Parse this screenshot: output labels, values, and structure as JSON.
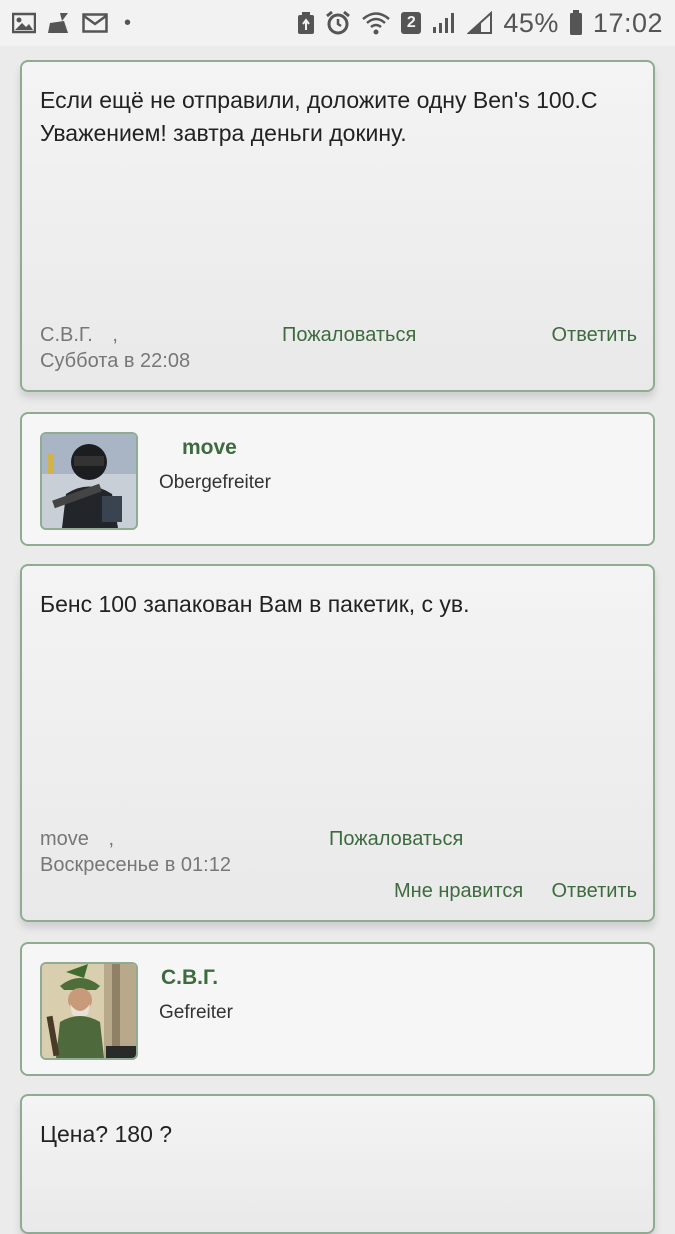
{
  "status_bar": {
    "battery": "45%",
    "time": "17:02",
    "sim_badge": "2",
    "icons": [
      "gallery-icon",
      "cleaner-icon",
      "mail-icon",
      "dot-icon",
      "battery-saver-icon",
      "alarm-icon",
      "wifi-icon",
      "signal-icon",
      "signal-icon",
      "battery-icon"
    ]
  },
  "colors": {
    "accent": "#3d6b3f",
    "border": "#8fab92",
    "meta": "#777777"
  },
  "posts": [
    {
      "text": "Если ещё не отправили, доложите одну Ben's 100.С Уважением! завтра деньги докину.",
      "author": "С.В.Г.",
      "comma": ",",
      "date": "Суббота в 22:08",
      "report": "Пожаловаться",
      "reply": "Ответить"
    },
    {
      "text": "Бенс 100 запакован Вам в пакетик, с ув.",
      "author": "move",
      "comma": ",",
      "date": "Воскресенье в 01:12",
      "report": "Пожаловаться",
      "like": "Мне нравится",
      "reply": "Ответить"
    },
    {
      "text": "Цена? 180 ?"
    }
  ],
  "authors": [
    {
      "name": "move",
      "rank": "Obergefreiter"
    },
    {
      "name": "С.В.Г.",
      "rank": "Gefreiter"
    }
  ]
}
